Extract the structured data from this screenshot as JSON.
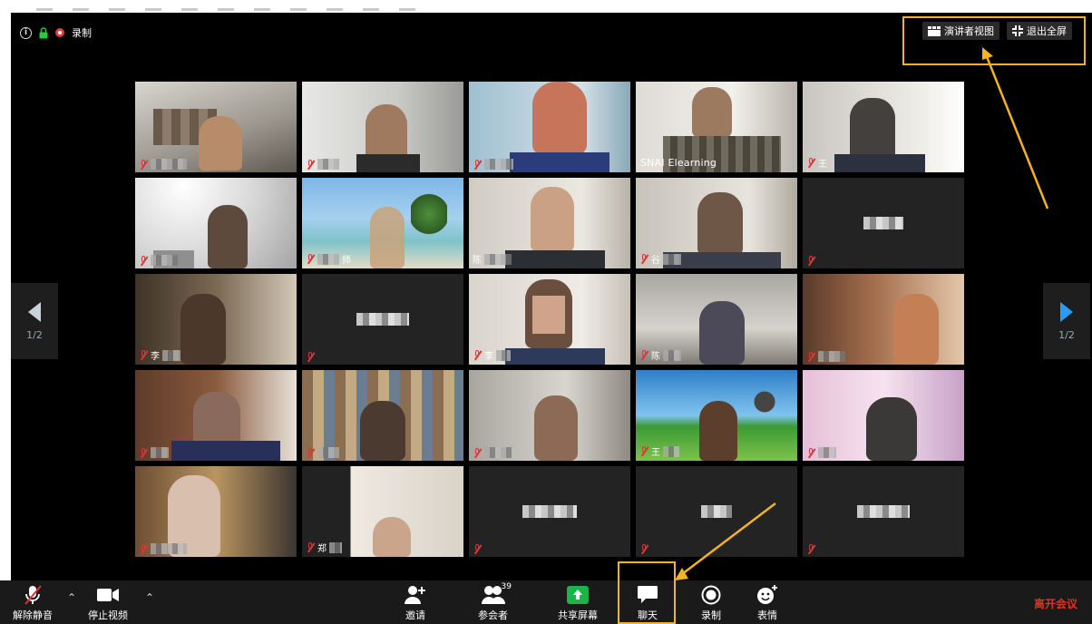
{
  "status": {
    "record_label": "录制"
  },
  "top_buttons": {
    "speaker_view": "演讲者视图",
    "exit_fullscreen": "退出全屏"
  },
  "pager": {
    "left": "1/2",
    "right": "1/2"
  },
  "tiles": [
    {
      "label": ""
    },
    {
      "label": ""
    },
    {
      "label": ""
    },
    {
      "label": "SNAI Elearning"
    },
    {
      "label": "王"
    },
    {
      "label": ""
    },
    {
      "label": "师"
    },
    {
      "label": "陈"
    },
    {
      "label": "谷"
    },
    {
      "label": ""
    },
    {
      "label": "李"
    },
    {
      "label": ""
    },
    {
      "label": "李"
    },
    {
      "label": "陈"
    },
    {
      "label": ""
    },
    {
      "label": ""
    },
    {
      "label": ""
    },
    {
      "label": ""
    },
    {
      "label": "王"
    },
    {
      "label": ""
    },
    {
      "label": ""
    },
    {
      "label": "郑"
    },
    {
      "label": ""
    },
    {
      "label": ""
    },
    {
      "label": ""
    }
  ],
  "toolbar": {
    "unmute": "解除静音",
    "stop_video": "停止视频",
    "invite": "邀请",
    "participants": "参会者",
    "participants_count": "39",
    "share_screen": "共享屏幕",
    "chat": "聊天",
    "record": "录制",
    "reactions": "表情",
    "leave": "离开会议"
  },
  "colors": {
    "active_speaker": "#c8ef4a",
    "highlight": "#f5b323",
    "leave_text": "#e0302b",
    "share_green": "#1bb34a"
  }
}
